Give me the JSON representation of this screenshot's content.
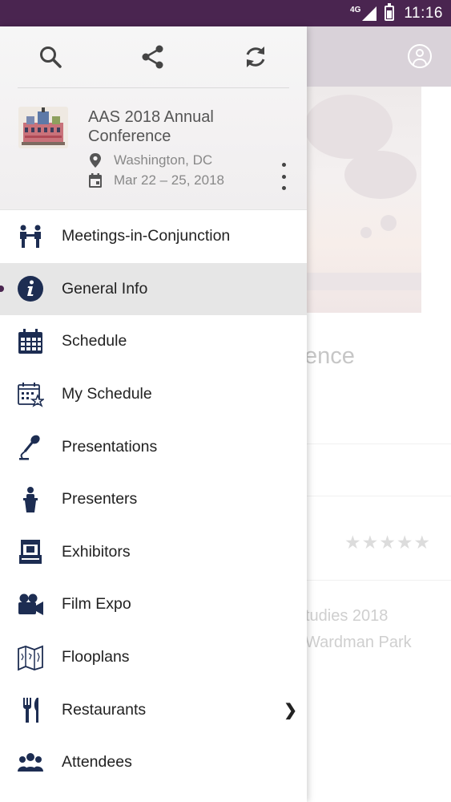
{
  "status_bar": {
    "network": "4G",
    "time": "11:16"
  },
  "header_icons": [
    "search-icon",
    "share-icon",
    "refresh-icon",
    "profile-icon"
  ],
  "conference": {
    "title": "AAS 2018 Annual Conference",
    "location": "Washington, DC",
    "dates": "Mar 22 – 25, 2018"
  },
  "menu": {
    "items": [
      {
        "label": "Meetings-in-Conjunction",
        "icon": "meeting-people-icon",
        "active": false
      },
      {
        "label": "General Info",
        "icon": "info-icon",
        "active": true
      },
      {
        "label": "Schedule",
        "icon": "calendar-icon",
        "active": false
      },
      {
        "label": "My Schedule",
        "icon": "calendar-star-icon",
        "active": false
      },
      {
        "label": "Presentations",
        "icon": "microphone-icon",
        "active": false
      },
      {
        "label": "Presenters",
        "icon": "podium-icon",
        "active": false
      },
      {
        "label": "Exhibitors",
        "icon": "booth-icon",
        "active": false
      },
      {
        "label": "Film Expo",
        "icon": "video-camera-icon",
        "active": false
      },
      {
        "label": "Flooplans",
        "icon": "map-icon",
        "active": false
      },
      {
        "label": "Restaurants",
        "icon": "fork-knife-icon",
        "active": false,
        "has_submenu": true
      },
      {
        "label": "Attendees",
        "icon": "group-icon",
        "active": false
      }
    ]
  },
  "background": {
    "title_fragment": "ence",
    "line1": "tudies 2018",
    "line2": "Wardman Park",
    "rating": "★★★★★"
  },
  "colors": {
    "status_bar": "#4a2550",
    "icon": "#1d2d52",
    "active_bg": "#e6e6e6"
  }
}
